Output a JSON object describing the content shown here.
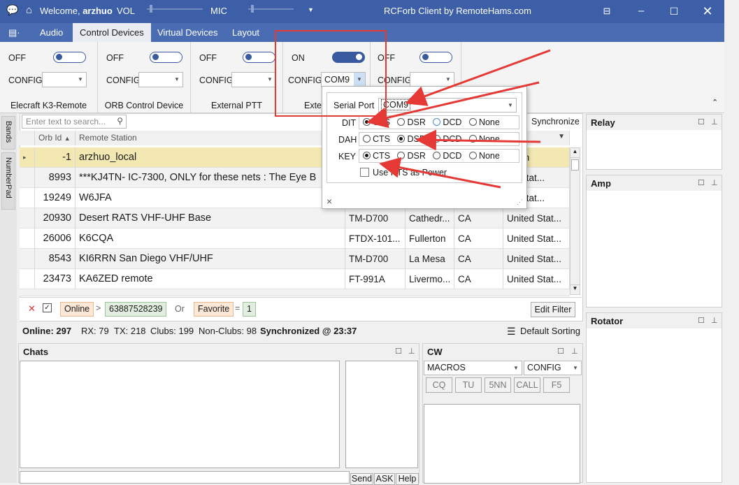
{
  "titlebar": {
    "welcome_prefix": "Welcome,",
    "username": "arzhuo",
    "vol_label": "VOL",
    "mic_label": "MIC",
    "title": "RCForb Client by RemoteHams.com"
  },
  "menu": {
    "tabs": [
      "Audio",
      "Control Devices",
      "Virtual Devices",
      "Layout"
    ],
    "active": "Control Devices"
  },
  "devices": [
    {
      "state": "OFF",
      "config_label": "CONFIG",
      "config_value": "",
      "name": "Elecraft K3-Remote",
      "on": false
    },
    {
      "state": "OFF",
      "config_label": "CONFIG",
      "config_value": "",
      "name": "ORB Control Device",
      "on": false
    },
    {
      "state": "OFF",
      "config_label": "CONFIG",
      "config_value": "",
      "name": "External PTT",
      "on": false
    },
    {
      "state": "ON",
      "config_label": "CONFIG",
      "config_value": "COM9",
      "name": "Exte",
      "on": true
    },
    {
      "state": "OFF",
      "config_label": "CONFIG",
      "config_value": "",
      "name": "",
      "on": false
    }
  ],
  "sidetabs": [
    "Bands",
    "NumberPad"
  ],
  "search": {
    "placeholder": "Enter text to search..."
  },
  "synchronize_label": "Synchronize",
  "grid": {
    "headers": [
      "Orb Id",
      "Remote Station",
      "",
      "",
      "",
      "y"
    ],
    "rows": [
      {
        "id": "-1",
        "station": "arzhuo_local",
        "radio": "",
        "city": "",
        "state": "",
        "country": "nown"
      },
      {
        "id": "8993",
        "station": "***KJ4TN- IC-7300, ONLY for these nets : The Eye B",
        "radio": "",
        "city": "",
        "state": "",
        "country": "ed Stat..."
      },
      {
        "id": "19249",
        "station": "W6JFA",
        "radio": "",
        "city": "",
        "state": "",
        "country": "ed Stat..."
      },
      {
        "id": "20930",
        "station": "Desert RATS VHF-UHF Base",
        "radio": "TM-D700",
        "city": "Cathedr...",
        "state": "CA",
        "country": "United Stat..."
      },
      {
        "id": "26006",
        "station": "K6CQA",
        "radio": "FTDX-101...",
        "city": "Fullerton",
        "state": "CA",
        "country": "United Stat..."
      },
      {
        "id": "8543",
        "station": "KI6RRN San Diego VHF/UHF",
        "radio": "TM-D700",
        "city": "La Mesa",
        "state": "CA",
        "country": "United Stat..."
      },
      {
        "id": "23473",
        "station": "KA6ZED remote",
        "radio": "FT-991A",
        "city": "Livermo...",
        "state": "CA",
        "country": "United Stat..."
      }
    ]
  },
  "filter": {
    "chip1": "Online",
    "op1": ">",
    "val1": "63887528239",
    "or": "Or",
    "chip2": "Favorite",
    "op2": "=",
    "val2": "1",
    "edit": "Edit Filter"
  },
  "status": {
    "online": "Online: 297",
    "rx": "RX: 79",
    "tx": "TX: 218",
    "clubs": "Clubs: 199",
    "nonclubs": "Non-Clubs: 98",
    "sync": "Synchronized @ 23:37",
    "sorting": "Default Sorting"
  },
  "panels": {
    "relay": "Relay",
    "amp": "Amp",
    "rotator": "Rotator",
    "chats": "Chats",
    "cw": "CW"
  },
  "cw": {
    "macros": "MACROS",
    "config": "CONFIG",
    "buttons": [
      "CQ",
      "TU",
      "5NN",
      "CALL",
      "F5"
    ]
  },
  "chat_buttons": [
    "Send",
    "ASK",
    "Help"
  ],
  "popup": {
    "serial_label": "Serial Port",
    "serial_value": "COM9",
    "dit": "DIT",
    "dah": "DAH",
    "key": "KEY",
    "opts": [
      "CTS",
      "DSR",
      "DCD",
      "None"
    ],
    "rts_label": "Use RTS as Power",
    "close": "×"
  }
}
